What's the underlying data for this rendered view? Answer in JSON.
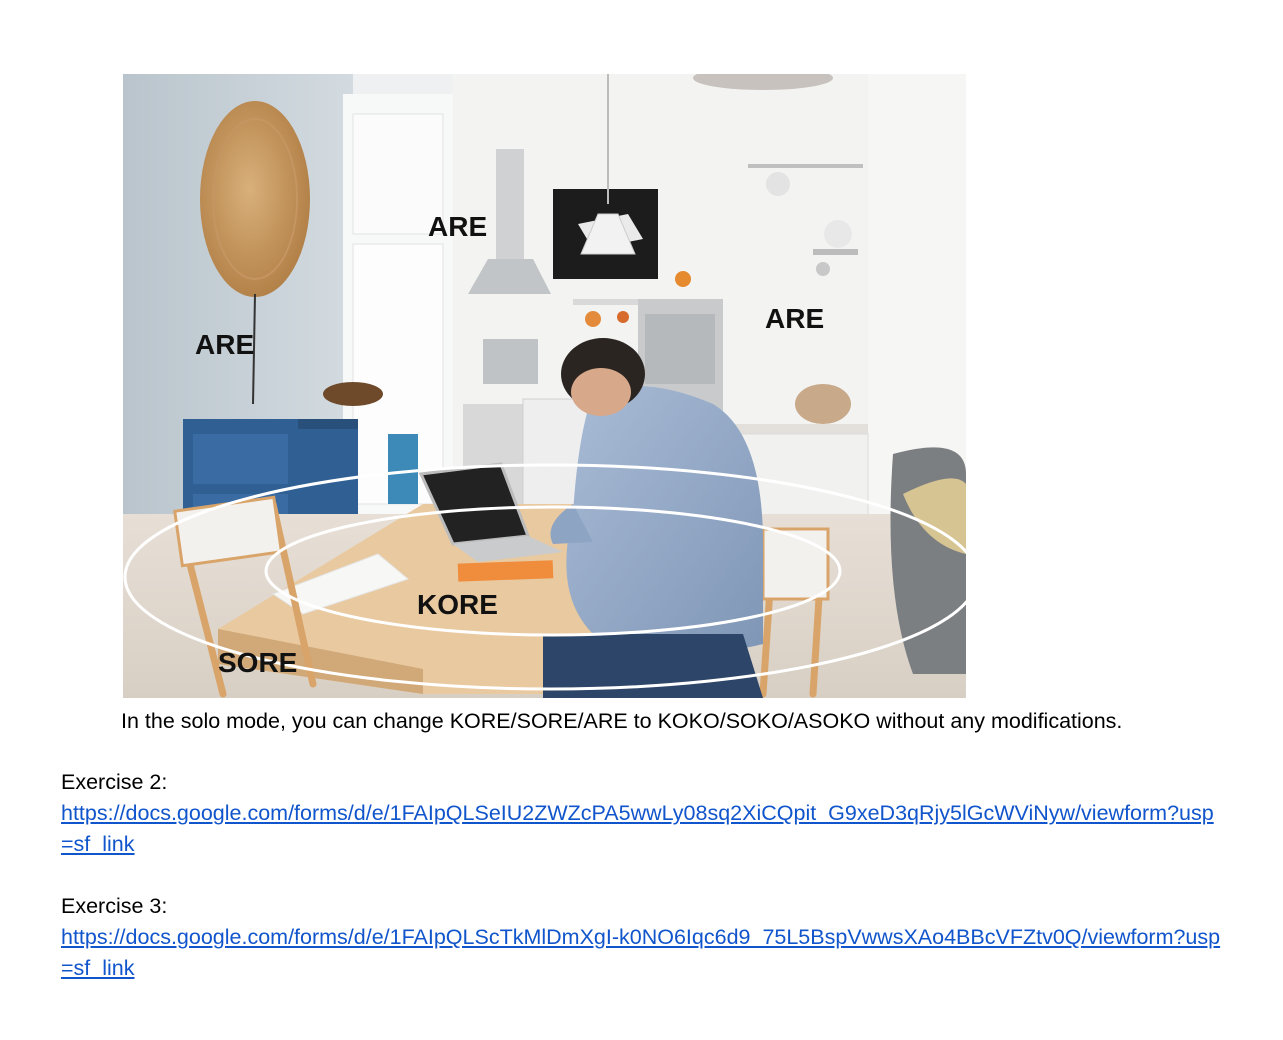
{
  "figure": {
    "zone_labels": {
      "are_left": "ARE",
      "are_center": "ARE",
      "are_right": "ARE",
      "kore": "KORE",
      "sore": "SORE"
    },
    "caption": "In the solo mode, you can change KORE/SORE/ARE to KOKO/SOKO/ASOKO without any modifications."
  },
  "exercises": [
    {
      "title": "Exercise 2:",
      "link": "https://docs.google.com/forms/d/e/1FAIpQLSeIU2ZWZcPA5wwLy08sq2XiCQpit_G9xeD3qRjy5lGcWViNyw/viewform?usp=sf_link"
    },
    {
      "title": "Exercise 3:",
      "link": "https://docs.google.com/forms/d/e/1FAIpQLScTkMlDmXgI-k0NO6Iqc6d9_75L5BspVwwsXAo4BBcVFZtv0Q/viewform?usp=sf_link"
    }
  ],
  "colors": {
    "link": "#1155cc",
    "wall_left": "#c9d3da",
    "cabinet_blue": "#2f5f93",
    "table_wood": "#e9c9a0"
  }
}
